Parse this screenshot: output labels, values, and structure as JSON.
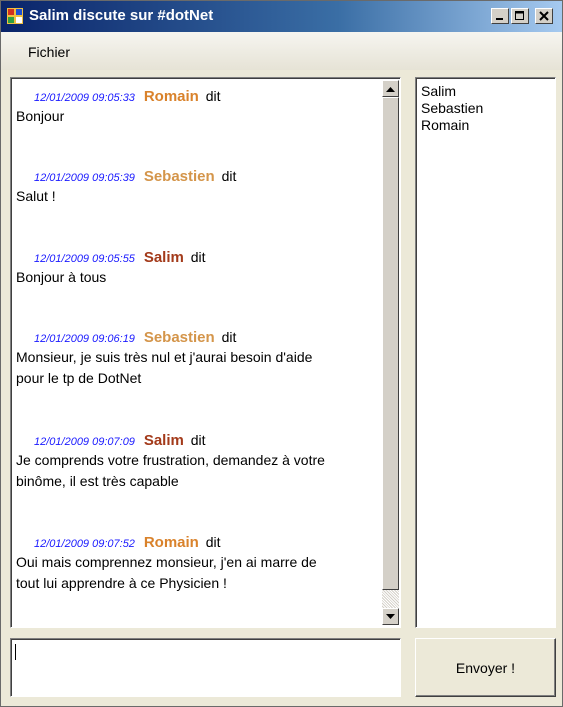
{
  "window": {
    "title": "Salim discute sur #dotNet"
  },
  "menu": {
    "items": [
      {
        "label": "Fichier"
      }
    ]
  },
  "colors": {
    "timestamp": "#1a1aff",
    "Romain": "#d9822b",
    "Sebastien": "#d4954a",
    "Salim": "#a33a1a"
  },
  "messages": [
    {
      "timestamp": "12/01/2009 09:05:33",
      "author": "Romain",
      "verb": "dit",
      "lines": [
        "Bonjour"
      ]
    },
    {
      "timestamp": "12/01/2009 09:05:39",
      "author": "Sebastien",
      "verb": "dit",
      "lines": [
        "Salut !"
      ]
    },
    {
      "timestamp": "12/01/2009 09:05:55",
      "author": "Salim",
      "verb": "dit",
      "lines": [
        "Bonjour à tous"
      ]
    },
    {
      "timestamp": "12/01/2009 09:06:19",
      "author": "Sebastien",
      "verb": "dit",
      "lines": [
        "Monsieur, je suis très nul et j'aurai besoin d'aide",
        "pour le tp de DotNet"
      ]
    },
    {
      "timestamp": "12/01/2009 09:07:09",
      "author": "Salim",
      "verb": "dit",
      "lines": [
        "Je comprends votre frustration, demandez à votre",
        "binôme, il est très capable"
      ]
    },
    {
      "timestamp": "12/01/2009 09:07:52",
      "author": "Romain",
      "verb": "dit",
      "lines": [
        "Oui mais comprennez monsieur, j'en ai marre de",
        "tout lui apprendre à ce Physicien !"
      ]
    }
  ],
  "users": [
    "Salim",
    "Sebastien",
    "Romain"
  ],
  "input": {
    "value": ""
  },
  "send_button": {
    "label": "Envoyer !"
  }
}
